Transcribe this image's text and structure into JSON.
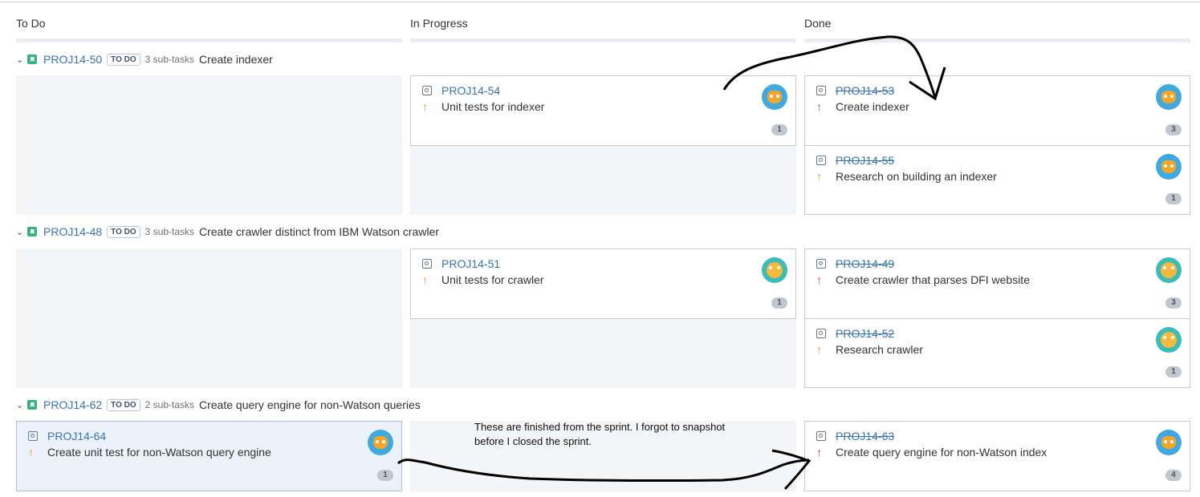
{
  "columns": [
    "To Do",
    "In Progress",
    "Done"
  ],
  "swimlanes": [
    {
      "key": "PROJ14-50",
      "status": "TO DO",
      "subtasks": "3 sub-tasks",
      "summary": "Create indexer"
    },
    {
      "key": "PROJ14-48",
      "status": "TO DO",
      "subtasks": "3 sub-tasks",
      "summary": "Create crawler distinct from IBM Watson crawler"
    },
    {
      "key": "PROJ14-62",
      "status": "TO DO",
      "subtasks": "2 sub-tasks",
      "summary": "Create query engine for non-Watson queries"
    }
  ],
  "cards": [
    {
      "key": "PROJ14-54",
      "summary": "Unit tests for indexer",
      "count": "1",
      "priority_icon": "arrow-up",
      "avatar": "cat"
    },
    {
      "key": "PROJ14-53",
      "summary": "Create indexer",
      "count": "3",
      "priority_icon": "arrow-up",
      "avatar": "cat"
    },
    {
      "key": "PROJ14-55",
      "summary": "Research on building an indexer",
      "count": "1",
      "priority_icon": "arrow-up",
      "avatar": "cat"
    },
    {
      "key": "PROJ14-51",
      "summary": "Unit tests for crawler",
      "count": "1",
      "priority_icon": "arrow-up",
      "avatar": "owl"
    },
    {
      "key": "PROJ14-49",
      "summary": "Create crawler that parses DFI website",
      "count": "3",
      "priority_icon": "arrow-up",
      "avatar": "owl"
    },
    {
      "key": "PROJ14-52",
      "summary": "Research crawler",
      "count": "1",
      "priority_icon": "arrow-up",
      "avatar": "owl"
    },
    {
      "key": "PROJ14-64",
      "summary": "Create unit test for non-Watson query engine",
      "count": "1",
      "priority_icon": "arrow-up",
      "avatar": "cat"
    },
    {
      "key": "PROJ14-63",
      "summary": "Create query engine for non-Watson index",
      "count": "4",
      "priority_icon": "arrow-up",
      "avatar": "cat"
    }
  ],
  "annotation": {
    "line1": "These are finished from the sprint. I forgot to snapshot",
    "line2": "before I closed the sprint."
  },
  "colors": {
    "link": "#3b73af",
    "priority_major": "#f79232",
    "priority_critical": "#d04437",
    "story": "#36b37e"
  }
}
